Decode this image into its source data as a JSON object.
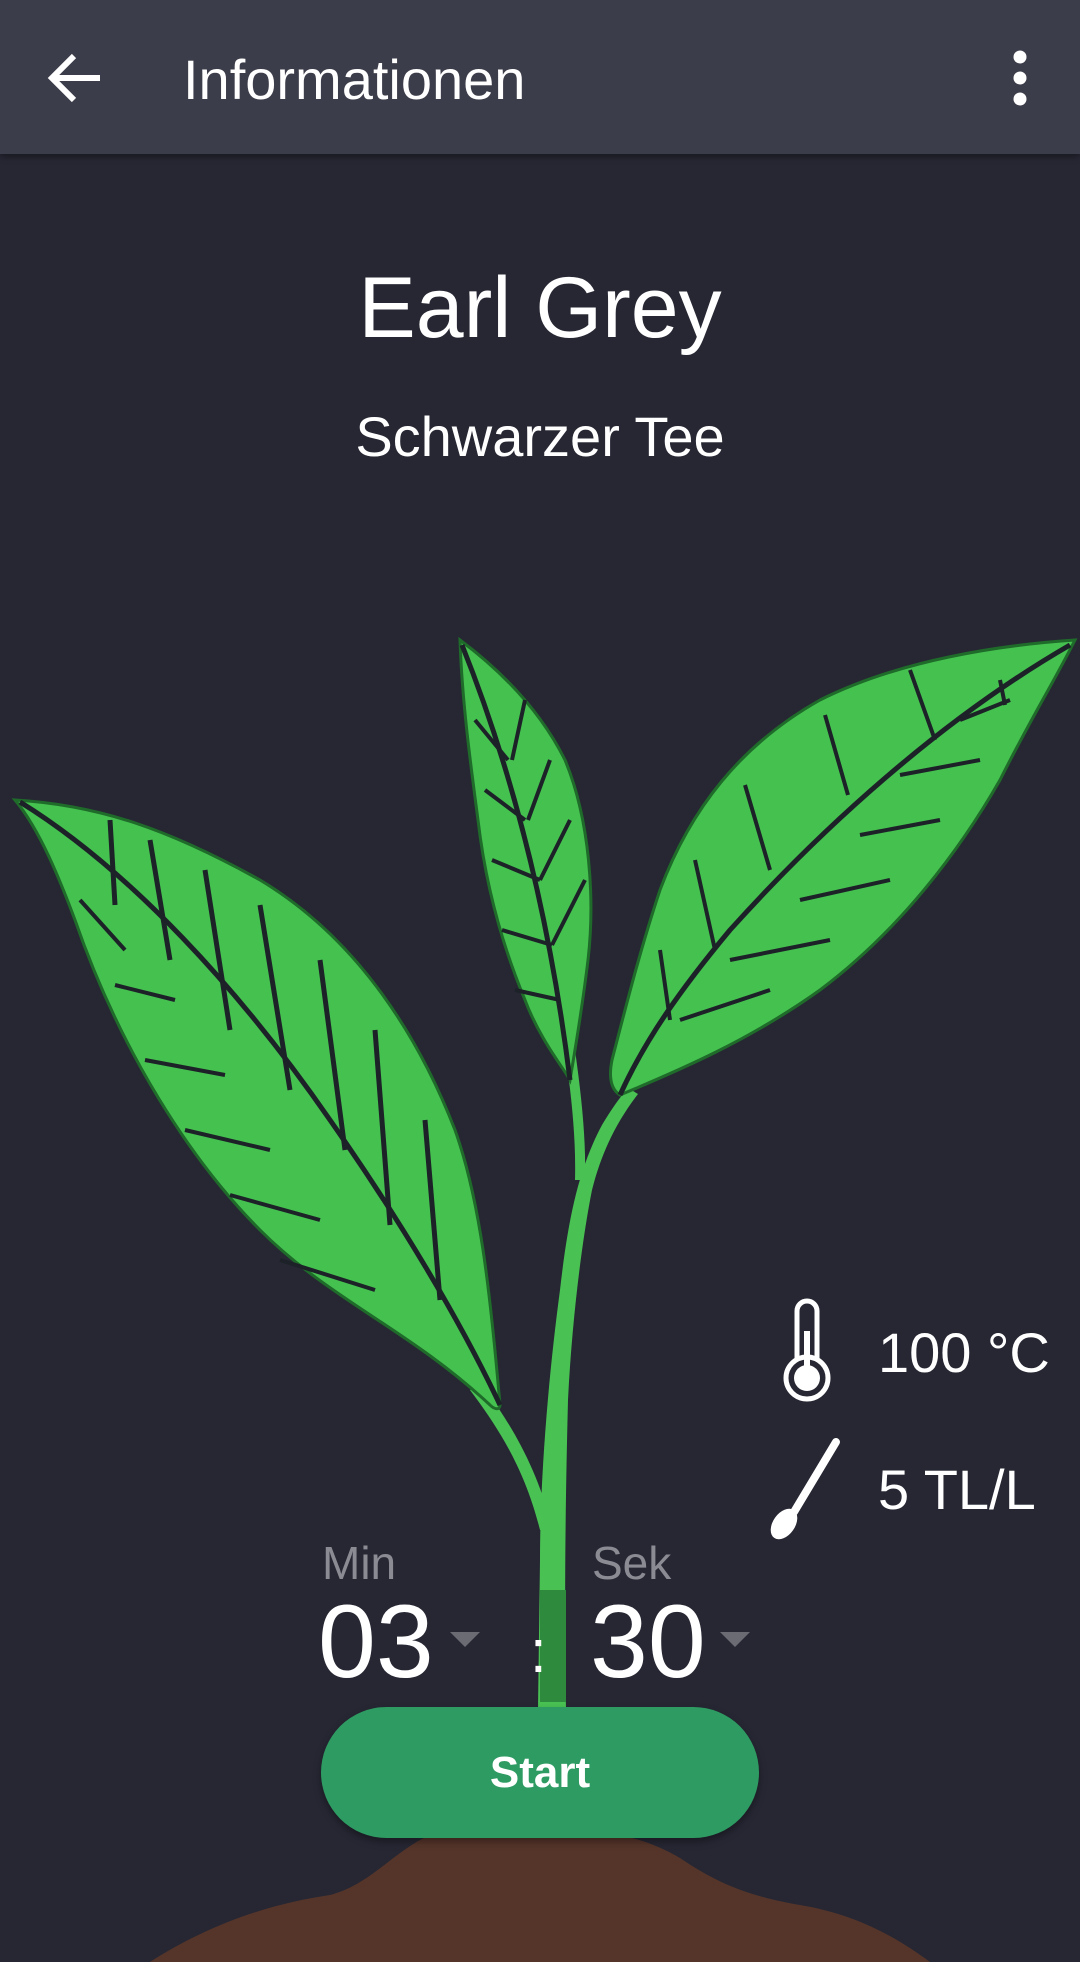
{
  "app_bar": {
    "title": "Informationen",
    "back_icon": "arrow-left-icon",
    "menu_icon": "more-vertical-icon"
  },
  "tea": {
    "name": "Earl Grey",
    "type": "Schwarzer Tee",
    "temperature": "100 °C",
    "amount": "5 TL/L"
  },
  "timer": {
    "minutes_label": "Min",
    "minutes": "03",
    "separator": ":",
    "seconds_label": "Sek",
    "seconds": "30"
  },
  "start_button": {
    "label": "Start"
  },
  "colors": {
    "background": "#262733",
    "app_bar": "#3c3d4a",
    "leaf": "#45c150",
    "stem": "#49c253",
    "soil": "#55352a",
    "button": "#2e9b62"
  }
}
